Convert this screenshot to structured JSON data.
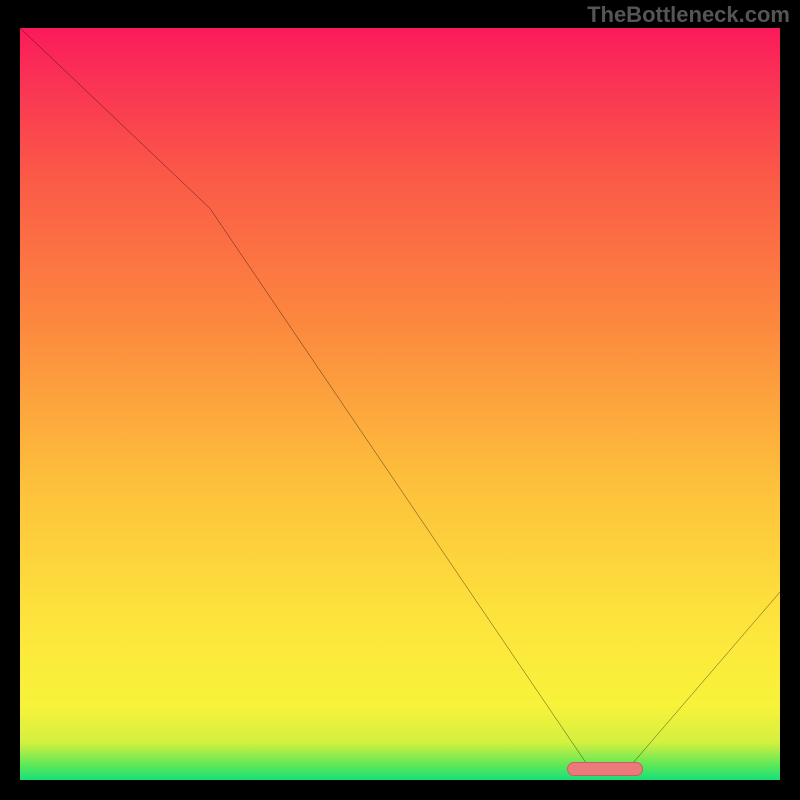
{
  "watermark": "TheBottleneck.com",
  "chart_data": {
    "type": "line",
    "title": "",
    "xlabel": "",
    "ylabel": "",
    "xlim": [
      0,
      100
    ],
    "ylim": [
      0,
      100
    ],
    "x": [
      0,
      25,
      75,
      80,
      100
    ],
    "values": [
      100,
      76,
      1.5,
      1.5,
      25
    ],
    "marker": {
      "x_start": 72,
      "x_end": 82,
      "y": 1.5
    },
    "background_gradient": {
      "stops": [
        {
          "pos": 0,
          "color": "#15e07a"
        },
        {
          "pos": 2,
          "color": "#5fe858"
        },
        {
          "pos": 5,
          "color": "#d4f03f"
        },
        {
          "pos": 10,
          "color": "#f8f23a"
        },
        {
          "pos": 20,
          "color": "#fde63c"
        },
        {
          "pos": 40,
          "color": "#fdbf3c"
        },
        {
          "pos": 60,
          "color": "#fc8a3e"
        },
        {
          "pos": 80,
          "color": "#fb5a47"
        },
        {
          "pos": 95,
          "color": "#fa2c56"
        },
        {
          "pos": 100,
          "color": "#fa1a5a"
        }
      ]
    }
  }
}
